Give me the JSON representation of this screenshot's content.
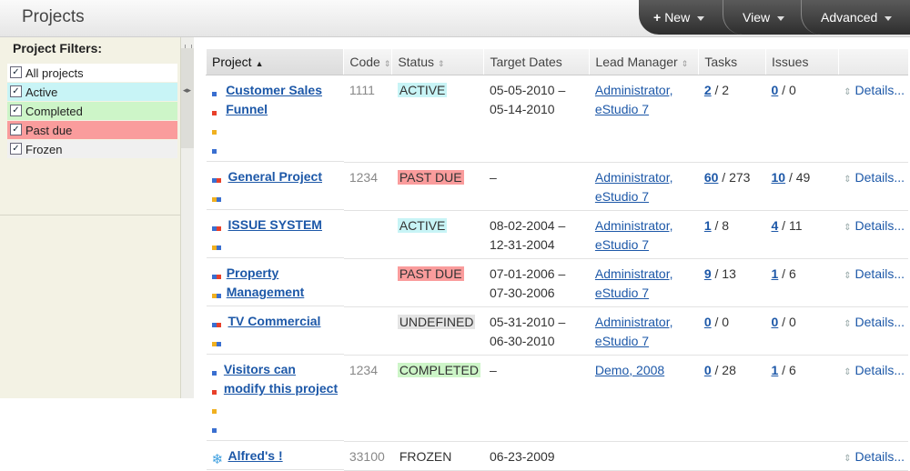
{
  "header": {
    "title": "Projects",
    "nav": [
      {
        "label": "New",
        "icon": "plus-icon"
      },
      {
        "label": "View"
      },
      {
        "label": "Advanced"
      }
    ]
  },
  "filters": {
    "title": "Project Filters:",
    "items": [
      {
        "label": "All projects",
        "checked": true,
        "color": "#ffffff"
      },
      {
        "label": "Active",
        "checked": true,
        "color": "#c8f4f6"
      },
      {
        "label": "Completed",
        "checked": true,
        "color": "#cdf5c8"
      },
      {
        "label": "Past due",
        "checked": true,
        "color": "#fa9c9c"
      },
      {
        "label": "Frozen",
        "checked": true,
        "color": "#f0f0f0"
      }
    ]
  },
  "table": {
    "columns": [
      "Project",
      "Code",
      "Status",
      "Target Dates",
      "Lead Manager",
      "Tasks",
      "Issues"
    ],
    "rows": [
      {
        "name": "Customer Sales Funnel",
        "code": "1111",
        "status": "ACTIVE",
        "status_color": "#c8f4f6",
        "dates": [
          "05-05-2010 –",
          "05-14-2010"
        ],
        "manager": [
          "Administrator,",
          "eStudio 7"
        ],
        "tasks_open": "2",
        "tasks_total": " / 2",
        "issues_open": "0",
        "issues_total": " / 0",
        "details": "Details...",
        "icon": "project-icon"
      },
      {
        "name": "General Project",
        "code": "1234",
        "status": "PAST DUE",
        "status_color": "#fa9c9c",
        "dates": [
          "–",
          ""
        ],
        "manager": [
          "Administrator,",
          "eStudio 7"
        ],
        "tasks_open": "60",
        "tasks_total": " / 273",
        "issues_open": "10",
        "issues_total": " / 49",
        "details": "Details...",
        "icon": "project-icon"
      },
      {
        "name": "ISSUE SYSTEM",
        "code": "",
        "status": "ACTIVE",
        "status_color": "#c8f4f6",
        "dates": [
          "08-02-2004 –",
          "12-31-2004"
        ],
        "manager": [
          "Administrator,",
          "eStudio 7"
        ],
        "tasks_open": "1",
        "tasks_total": " / 8",
        "issues_open": "4",
        "issues_total": " / 11",
        "details": "Details...",
        "icon": "project-icon"
      },
      {
        "name": "Property Management",
        "code": "",
        "status": "PAST DUE",
        "status_color": "#fa9c9c",
        "dates": [
          "07-01-2006 –",
          "07-30-2006"
        ],
        "manager": [
          "Administrator,",
          "eStudio 7"
        ],
        "tasks_open": "9",
        "tasks_total": " / 13",
        "issues_open": "1",
        "issues_total": " / 6",
        "details": "Details...",
        "icon": "project-icon"
      },
      {
        "name": "TV Commercial",
        "code": "",
        "status": "UNDEFINED",
        "status_color": "#e4e4e4",
        "dates": [
          "05-31-2010 –",
          "06-30-2010"
        ],
        "manager": [
          "Administrator,",
          "eStudio 7"
        ],
        "tasks_open": "0",
        "tasks_total": " / 0",
        "issues_open": "0",
        "issues_total": " / 0",
        "details": "Details...",
        "icon": "project-icon"
      },
      {
        "name": "Visitors can modify this project",
        "code": "1234",
        "status": "COMPLETED",
        "status_color": "#cdf5c8",
        "dates": [
          "–",
          ""
        ],
        "manager": [
          "Demo, 2008",
          ""
        ],
        "tasks_open": "0",
        "tasks_total": " / 28",
        "issues_open": "1",
        "issues_total": " / 6",
        "details": "Details...",
        "icon": "project-icon"
      },
      {
        "name": "Alfred's !",
        "code": "33100",
        "status": "FROZEN",
        "status_color": "#ffffff",
        "dates": [
          "06-23-2009",
          ""
        ],
        "manager": [
          "",
          ""
        ],
        "tasks_open": "",
        "tasks_total": "",
        "issues_open": "",
        "issues_total": "",
        "details": "Details...",
        "icon": "snowflake-icon"
      }
    ]
  }
}
